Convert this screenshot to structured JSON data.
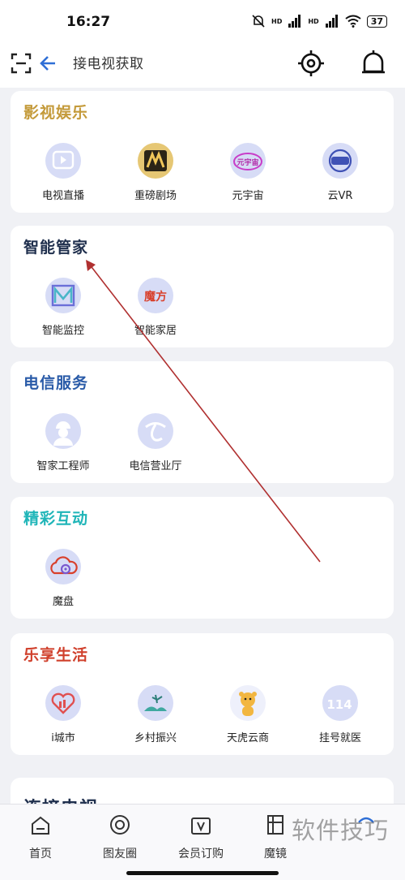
{
  "status_bar": {
    "time": "16:27",
    "signal_label_1": "HD",
    "signal_label_2": "HD",
    "battery": "37"
  },
  "header": {
    "title": "接电视获取"
  },
  "sections": [
    {
      "title": "影视娱乐",
      "title_color": "#c49a3a",
      "items": [
        {
          "label": "电视直播",
          "icon": "tv-play-icon"
        },
        {
          "label": "重磅剧场",
          "icon": "theater-icon"
        },
        {
          "label": "元宇宙",
          "icon": "metaverse-icon",
          "icon_text": "元宇宙"
        },
        {
          "label": "云VR",
          "icon": "vr-headset-icon"
        }
      ]
    },
    {
      "title": "智能管家",
      "title_color": "#1f2f4d",
      "items": [
        {
          "label": "智能监控",
          "icon": "monitor-icon"
        },
        {
          "label": "智能家居",
          "icon": "smart-home-icon",
          "icon_text": "魔方"
        }
      ]
    },
    {
      "title": "电信服务",
      "title_color": "#2a5ba8",
      "items": [
        {
          "label": "智家工程师",
          "icon": "engineer-icon"
        },
        {
          "label": "电信营业厅",
          "icon": "telecom-icon"
        }
      ]
    },
    {
      "title": "精彩互动",
      "title_color": "#1fb5b8",
      "items": [
        {
          "label": "魔盘",
          "icon": "cloud-disk-icon"
        }
      ]
    },
    {
      "title": "乐享生活",
      "title_color": "#d0402c",
      "items": [
        {
          "label": "i城市",
          "icon": "city-heart-icon"
        },
        {
          "label": "乡村振兴",
          "icon": "village-icon"
        },
        {
          "label": "天虎云商",
          "icon": "tiger-icon"
        },
        {
          "label": "挂号就医",
          "icon": "hospital-114-icon",
          "icon_text": "114"
        }
      ]
    },
    {
      "title": "连接电视",
      "title_color": "#1f2f4d"
    }
  ],
  "bottom_nav": [
    {
      "label": "首页",
      "icon": "home-icon"
    },
    {
      "label": "图友圈",
      "icon": "circle-icon"
    },
    {
      "label": "会员订购",
      "icon": "vip-icon"
    },
    {
      "label": "魔镜",
      "icon": "mirror-icon"
    },
    {
      "label": "",
      "icon": "more-icon"
    }
  ],
  "watermark": "软件技巧",
  "colors": {
    "accent_blue": "#2f6fd6",
    "icon_bg": "#d7dcf6",
    "annotation_red": "#b03030"
  }
}
